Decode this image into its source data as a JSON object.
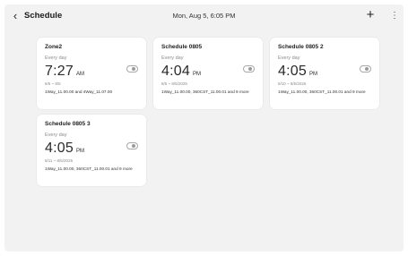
{
  "header": {
    "back_icon": "chevron-left",
    "title": "Schedule",
    "datetime": "Mon, Aug 5, 6:05 PM",
    "add_icon": "+",
    "more_icon": "⋮"
  },
  "schedules": [
    {
      "name": "Zone2",
      "repeat": "Every day",
      "time": "7:27",
      "ampm": "AM",
      "range": "8/5 ~ 8/5",
      "zones": "1Way_11.00.00 and 4Way_11.07.00",
      "enabled": false
    },
    {
      "name": "Schedule 0805",
      "repeat": "Every day",
      "time": "4:04",
      "ampm": "PM",
      "range": "8/5 ~ 8/5/2025",
      "zones": "1Way_11.00.00, 360CST_11.00.01 and 9 more",
      "enabled": false
    },
    {
      "name": "Schedule 0805 2",
      "repeat": "Every day",
      "time": "4:05",
      "ampm": "PM",
      "range": "8/10 ~ 8/5/2025",
      "zones": "1Way_11.00.00, 360CST_11.00.01 and 9 more",
      "enabled": false
    },
    {
      "name": "Schedule 0805 3",
      "repeat": "Every day",
      "time": "4:05",
      "ampm": "PM",
      "range": "8/11 ~ 8/5/2025",
      "zones": "1Way_11.00.00, 360CST_11.00.01 and 9 more",
      "enabled": false
    }
  ]
}
